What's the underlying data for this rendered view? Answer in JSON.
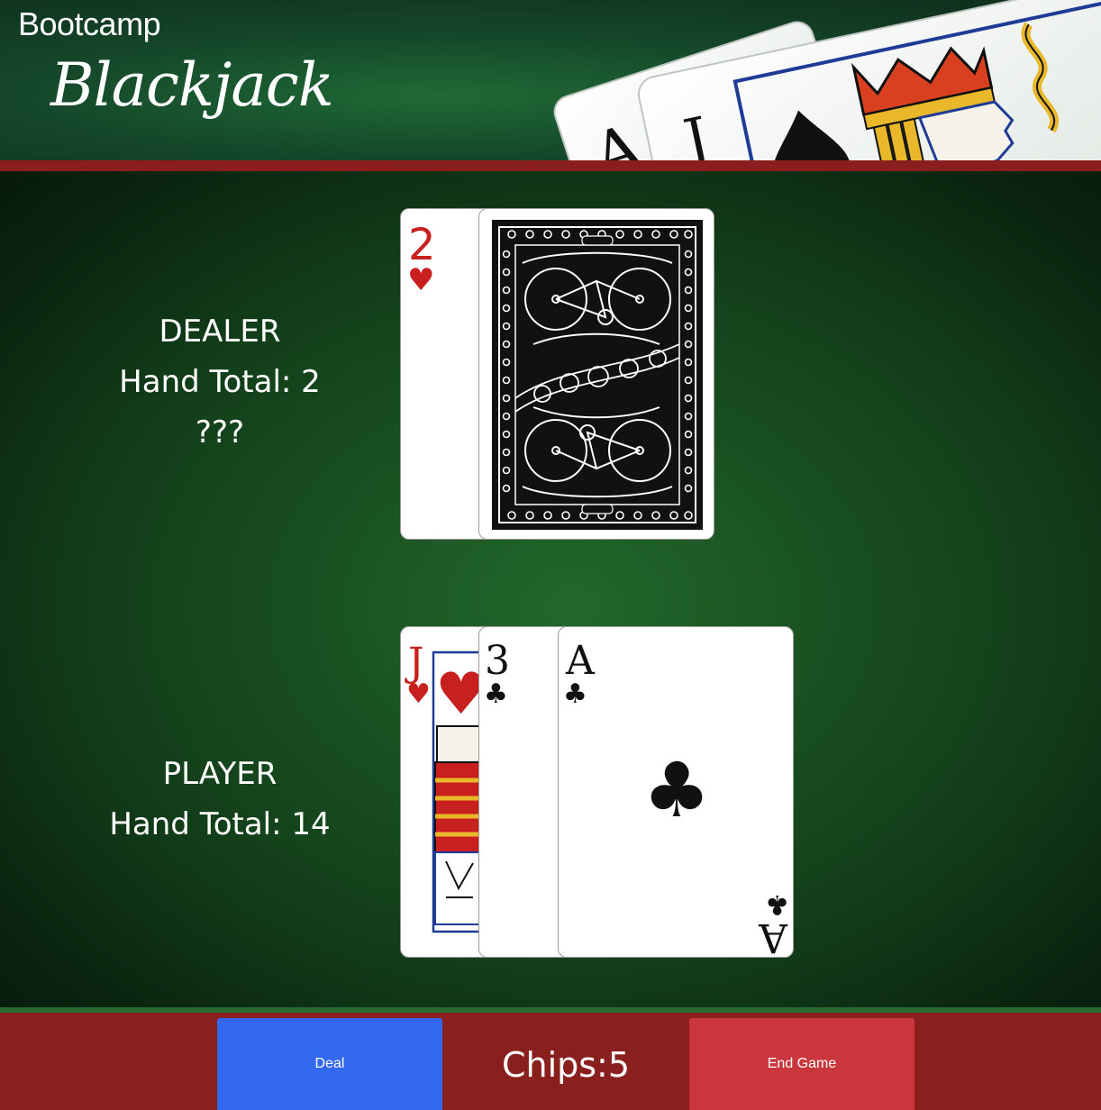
{
  "header": {
    "brand": "Bootcamp",
    "logo": "Blackjack",
    "hero_cards": [
      {
        "rank": "A",
        "suit": "spades"
      },
      {
        "rank": "J",
        "suit": "spades"
      }
    ]
  },
  "dealer": {
    "label": "DEALER",
    "hand_total_label": "Hand Total: 2",
    "hidden_text": "???",
    "cards": [
      {
        "rank": "2",
        "suit": "hearts",
        "suit_symbol": "♥",
        "face_up": true
      },
      {
        "face_up": false,
        "back_design": "bicycle-card-back"
      }
    ]
  },
  "player": {
    "label": "PLAYER",
    "hand_total_label": "Hand Total: 14",
    "cards": [
      {
        "rank": "J",
        "suit": "hearts",
        "suit_symbol": "♥",
        "face_up": true
      },
      {
        "rank": "3",
        "suit": "clubs",
        "suit_symbol": "♣",
        "face_up": true
      },
      {
        "rank": "A",
        "suit": "clubs",
        "suit_symbol": "♣",
        "face_up": true
      }
    ]
  },
  "footer": {
    "deal_label": "Deal",
    "chips_label": "Chips:",
    "chips_value": "5",
    "end_game_label": "End Game"
  },
  "colors": {
    "header_rule": "#8a1e1e",
    "footer_bg": "#8a201e",
    "deal_button": "#3269f0",
    "end_game_button": "#c9373d",
    "felt": "#1a5222",
    "red_suit": "#c8201e",
    "black_suit": "#111111"
  }
}
